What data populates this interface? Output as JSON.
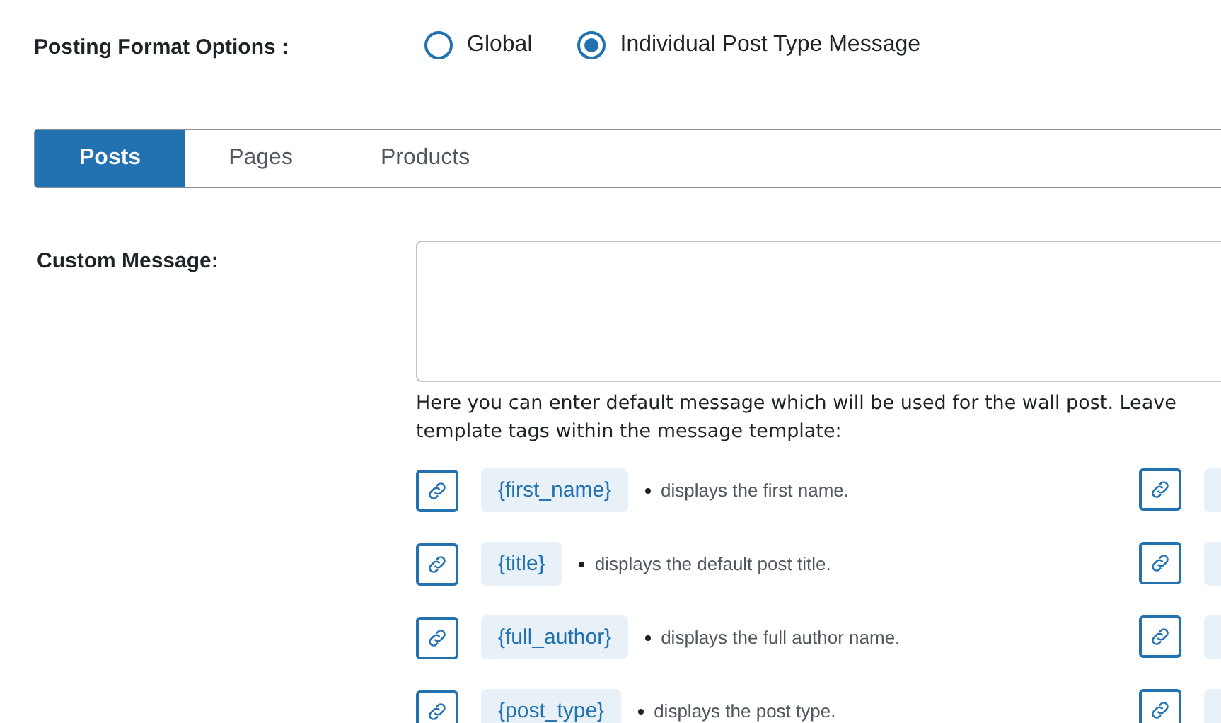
{
  "posting_format": {
    "label": "Posting Format Options :",
    "options": [
      {
        "label": "Global",
        "selected": false
      },
      {
        "label": "Individual Post Type Message",
        "selected": true
      }
    ]
  },
  "tabs": [
    {
      "label": "Posts",
      "selected": true
    },
    {
      "label": "Pages",
      "selected": false
    },
    {
      "label": "Products",
      "selected": false
    }
  ],
  "custom_message": {
    "label": "Custom Message:",
    "description": "Here you can enter default message which will be used for the wall post. Leave\ntemplate tags within the message template:"
  },
  "template_tags": [
    {
      "tag": "{first_name}",
      "description": "displays the first name."
    },
    {
      "tag": "{title}",
      "description": "displays the default post title."
    },
    {
      "tag": "{full_author}",
      "description": "displays the full author name."
    },
    {
      "tag": "{post_type}",
      "description": "displays the post type."
    }
  ]
}
